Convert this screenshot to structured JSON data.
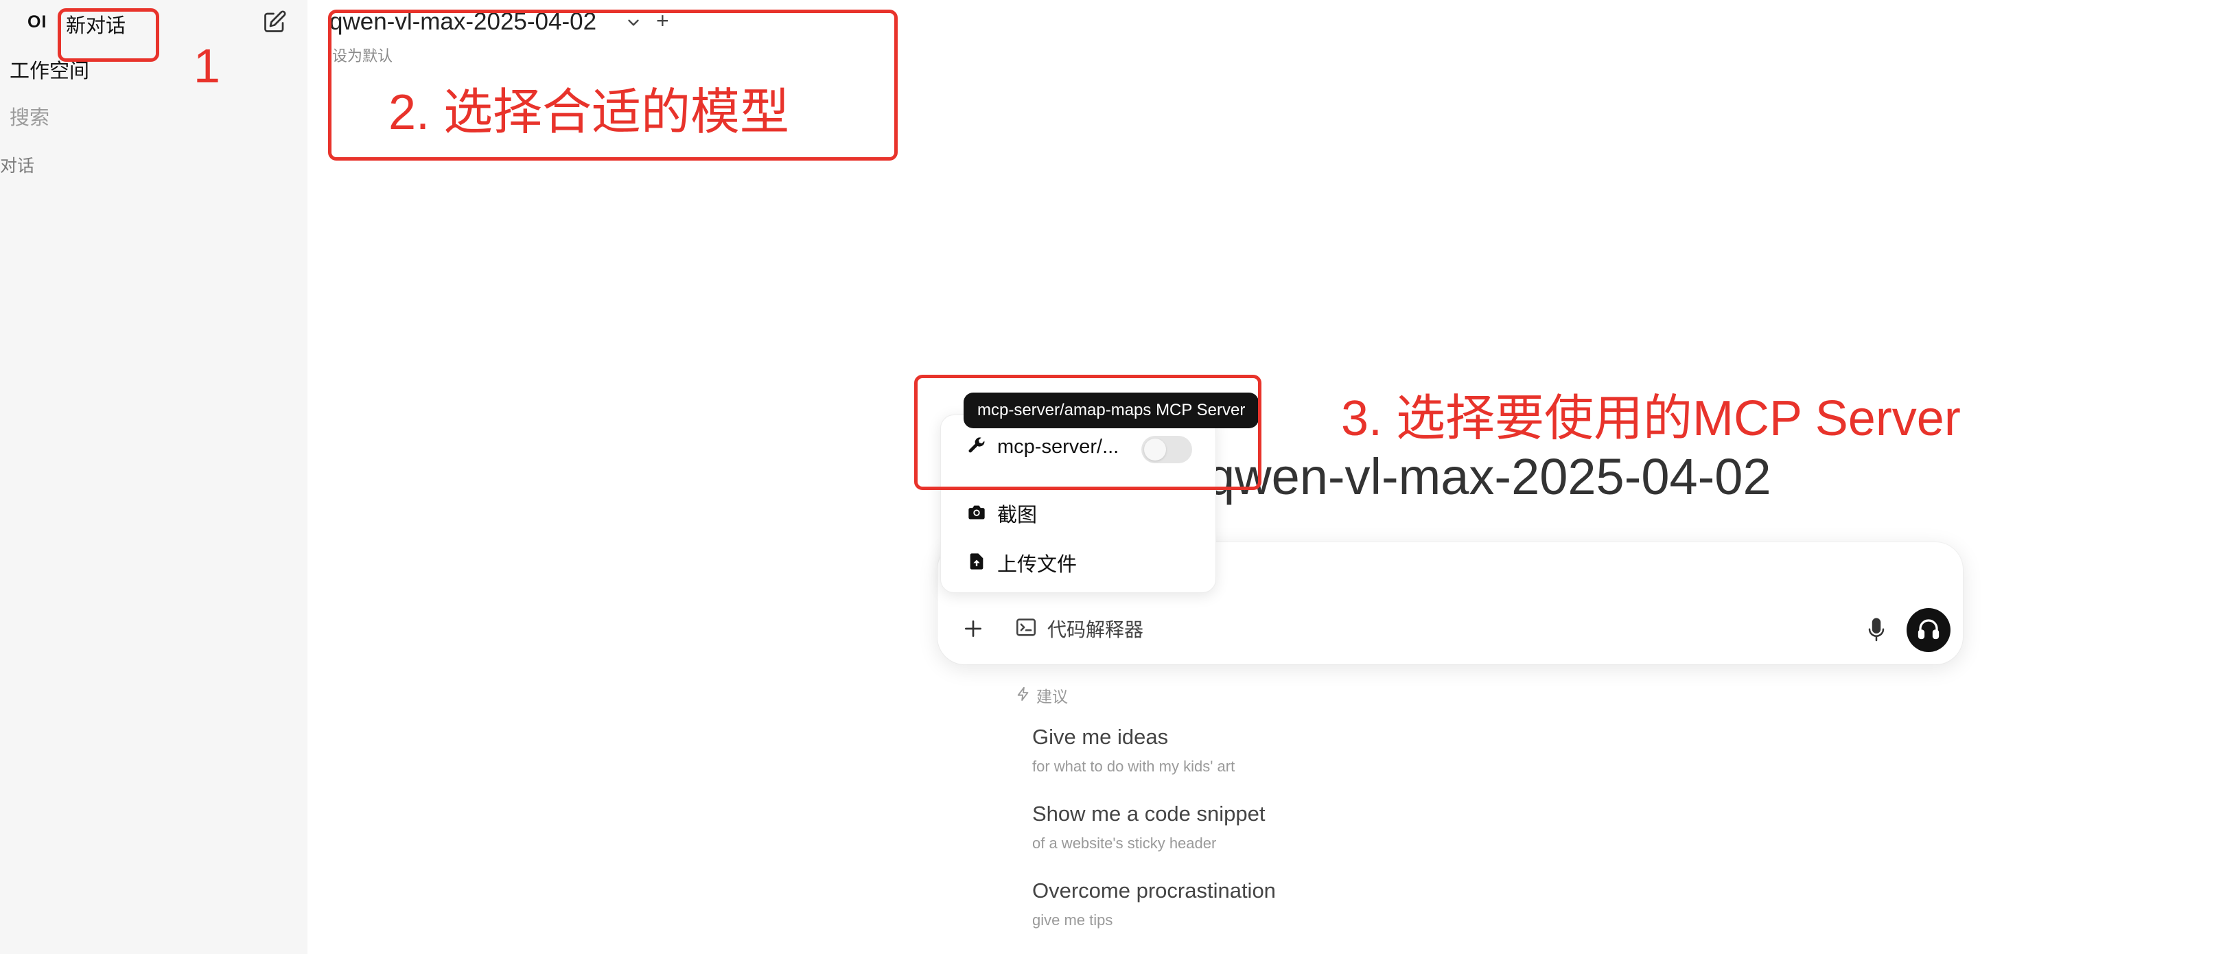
{
  "sidebar": {
    "logo": "OI",
    "new_chat": "新对话",
    "workspace": "工作空间",
    "search_placeholder": "搜索",
    "section_label": "对话"
  },
  "header": {
    "model_name": "qwen-vl-max-2025-04-02",
    "add_model": "+",
    "set_default": "设为默认"
  },
  "main": {
    "model_title": "qwen-vl-max-2025-04-02",
    "code_interpreter": "代码解释器"
  },
  "tools_menu": {
    "tooltip": "mcp-server/amap-maps MCP Server",
    "items": [
      {
        "label": "mcp-server/...",
        "icon": "wrench-icon",
        "toggle_on": false
      },
      {
        "label": "截图",
        "icon": "camera-icon"
      },
      {
        "label": "上传文件",
        "icon": "file-upload-icon"
      }
    ]
  },
  "suggestions": {
    "header": "建议",
    "items": [
      {
        "title": "Give me ideas",
        "subtitle": "for what to do with my kids' art"
      },
      {
        "title": "Show me a code snippet",
        "subtitle": "of a website's sticky header"
      },
      {
        "title": "Overcome procrastination",
        "subtitle": "give me tips"
      }
    ]
  },
  "annotations": {
    "label_1": "1",
    "label_2": "2. 选择合适的模型",
    "label_3": "3. 选择要使用的MCP Server",
    "color": "#e8332b"
  }
}
